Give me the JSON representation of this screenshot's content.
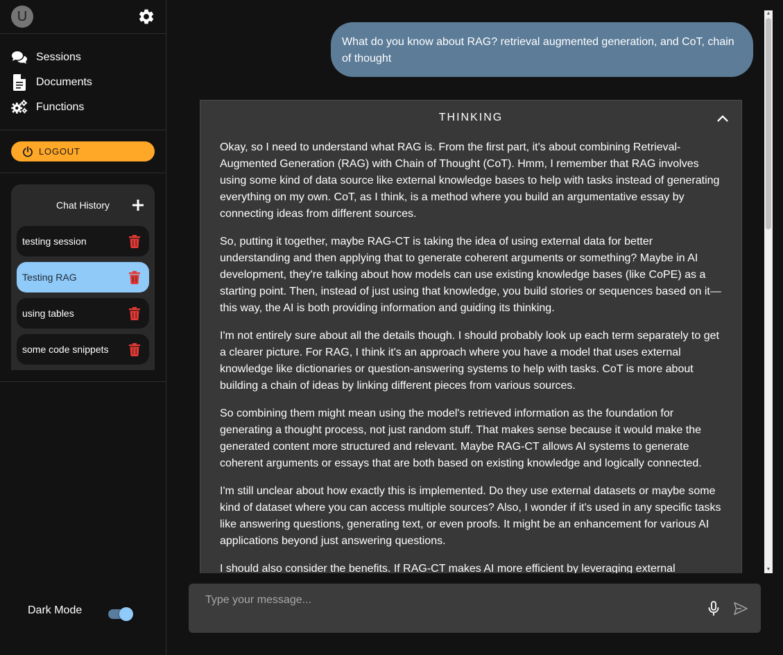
{
  "user": {
    "avatar_initial": "U"
  },
  "sidebar": {
    "nav": [
      {
        "label": "Sessions",
        "icon": "chat-bubbles-icon"
      },
      {
        "label": "Documents",
        "icon": "document-icon"
      },
      {
        "label": "Functions",
        "icon": "gears-icon"
      }
    ],
    "logout_label": "LOGOUT",
    "chat_history": {
      "title": "Chat History",
      "sessions": [
        {
          "label": "testing session",
          "active": false
        },
        {
          "label": "Testing RAG",
          "active": true
        },
        {
          "label": "using tables",
          "active": false
        },
        {
          "label": "some code snippets",
          "active": false
        }
      ]
    },
    "dark_mode": {
      "label": "Dark Mode",
      "enabled": true
    }
  },
  "conversation": {
    "user_message": "What do you know about RAG? retrieval augmented generation, and CoT, chain of thought",
    "thinking": {
      "title": "THINKING",
      "expanded": true,
      "paragraphs": [
        "Okay, so I need to understand what RAG is. From the first part, it's about combining Retrieval-Augmented Generation (RAG) with Chain of Thought (CoT). Hmm, I remember that RAG involves using some kind of data source like external knowledge bases to help with tasks instead of generating everything on my own. CoT, as I think, is a method where you build an argumentative essay by connecting ideas from different sources.",
        "So, putting it together, maybe RAG-CT is taking the idea of using external data for better understanding and then applying that to generate coherent arguments or something? Maybe in AI development, they're talking about how models can use existing knowledge bases (like CoPE) as a starting point. Then, instead of just using that knowledge, you build stories or sequences based on it—this way, the AI is both providing information and guiding its thinking.",
        "I'm not entirely sure about all the details though. I should probably look up each term separately to get a clearer picture. For RAG, I think it's an approach where you have a model that uses external knowledge like dictionaries or question-answering systems to help with tasks. CoT is more about building a chain of ideas by linking different pieces from various sources.",
        "So combining them might mean using the model's retrieved information as the foundation for generating a thought process, not just random stuff. That makes sense because it would make the generated content more structured and relevant. Maybe RAG-CT allows AI systems to generate coherent arguments or essays that are both based on existing knowledge and logically connected.",
        "I'm still unclear about how exactly this is implemented. Do they use external datasets or maybe some kind of dataset where you can access multiple sources? Also, I wonder if it's used in any specific tasks like answering questions, generating text, or even proofs. It might be an enhancement for various AI applications beyond just answering questions.",
        "I should also consider the benefits. If RAG-CT makes AI more efficient by leveraging external"
      ]
    }
  },
  "composer": {
    "placeholder": "Type your message..."
  },
  "colors": {
    "accent": "#90caf9",
    "logout": "#ffa726",
    "user_bubble": "#5c7c98",
    "delete": "#e53935",
    "panel": "#383838"
  }
}
